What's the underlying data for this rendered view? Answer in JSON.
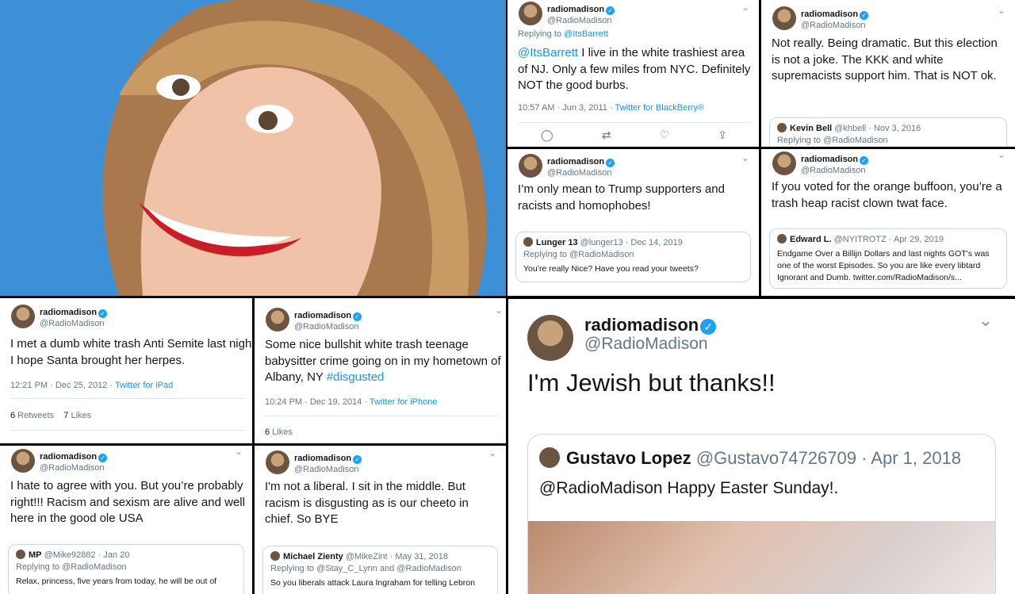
{
  "tweets": [
    {
      "name": "radiomadison",
      "handle": "@RadioMadison",
      "replying": "Replying to",
      "replying_to": "@ItsBarrett",
      "mention": "@ItsBarrett",
      "text": " I live in the white trashiest area of NJ. Only a few miles from NYC. Definitely NOT the good burbs.",
      "time": "10:57 AM · Jun 3, 2011 · ",
      "source": "Twitter for BlackBerry®"
    },
    {
      "name": "radiomadison",
      "handle": "@RadioMadison",
      "text": "Not really. Being dramatic. But this election is not a joke. The KKK and white supremacists support him. That is NOT ok.",
      "quote": {
        "name": "Kevin Bell",
        "meta": "@khbell · Nov 3, 2016",
        "replying": "Replying to @RadioMadison"
      }
    },
    {
      "name": "radiomadison",
      "handle": "@RadioMadison",
      "text": "I’m only mean to Trump supporters and racists and homophobes!",
      "quote": {
        "name": "Lunger 13",
        "meta": "@lunger13 · Dec 14, 2019",
        "replying": "Replying to @RadioMadison",
        "text": "You’re really Nice? Have you read your tweets?"
      }
    },
    {
      "name": "radiomadison",
      "handle": "@RadioMadison",
      "text": "If you voted for the orange buffoon, you’re a trash heap racist clown twat face.",
      "quote": {
        "name": "Edward L.",
        "meta": "@NYITROTZ · Apr 29, 2019",
        "text": "Endgame Over a Billijn Dollars and last nights GOT's was one of the worst Episodes. So you are like every libtard Ignorant and Dumb. twitter.com/RadioMadison/s..."
      }
    },
    {
      "name": "radiomadison",
      "handle": "@RadioMadison",
      "text": "I met a dumb white trash Anti Semite last night. I hope Santa brought her herpes.",
      "time": "12:21 PM · Dec 25, 2012 · ",
      "source": "Twitter for iPad",
      "retweets_count": "6",
      "retweets_label": " Retweets",
      "likes_count": "7",
      "likes_label": " Likes"
    },
    {
      "name": "radiomadison",
      "handle": "@RadioMadison",
      "text": "Some nice bullshit white trash teenage babysitter crime going on in my hometown of Albany, NY ",
      "hashtag": "#disgusted",
      "time": "10:24 PM · Dec 19, 2014 · ",
      "source": "Twitter for iPhone",
      "likes_count": "6",
      "likes_label": " Likes"
    },
    {
      "name": "radiomadison",
      "handle": "@RadioMadison",
      "text": "I hate to agree with you. But you’re probably right!!! Racism and sexism are alive and well here in the good ole USA",
      "quote": {
        "name": "MP",
        "meta": "@Mike92882 · Jan 20",
        "replying": "Replying to @RadioMadison",
        "text": "Relax, princess, five years from today, he will be out of"
      }
    },
    {
      "name": "radiomadison",
      "handle": "@RadioMadison",
      "text": "I'm not a liberal. I sit in the middle. But racism is disgusting as is our cheeto in chief. So BYE",
      "quote": {
        "name": "Michael Zienty",
        "meta": "@MikeZint · May 31, 2018",
        "replying": "Replying to @Stay_C_Lynn and @RadioMadison",
        "text": "So you liberals attack Laura Ingraham for telling Lebron"
      }
    },
    {
      "name": "radiomadison",
      "handle": "@RadioMadison",
      "text": "I'm Jewish but thanks!!",
      "quote": {
        "name": "Gustavo Lopez",
        "meta": "@Gustavo74726709 · Apr 1, 2018",
        "text": "@RadioMadison Happy Easter Sunday!."
      }
    }
  ],
  "icons": {
    "verified": "✓",
    "chevron": "⌄",
    "reply": "◯",
    "retweet": "⇄",
    "like": "♡",
    "share": "⇪"
  },
  "colors": {
    "link": "#1b95e0",
    "verified": "#1da1f2",
    "photo_bg": "#3d8fd6"
  }
}
